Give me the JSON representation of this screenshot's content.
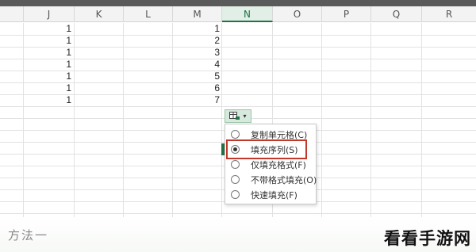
{
  "columns": [
    "J",
    "K",
    "L",
    "M",
    "N",
    "O",
    "P",
    "Q",
    "R"
  ],
  "selected_column": "N",
  "column_j_values": [
    "1",
    "1",
    "1",
    "1",
    "1",
    "1",
    "1"
  ],
  "column_m_values": [
    "1",
    "2",
    "3",
    "4",
    "5",
    "6",
    "7"
  ],
  "fill_button": {
    "icon": "autofill-options-icon",
    "caret": "▾"
  },
  "menu": {
    "items": [
      {
        "label": "复制单元格(C)",
        "checked": false
      },
      {
        "label": "填充序列(S)",
        "checked": true
      },
      {
        "label": "仅填充格式(F)",
        "checked": false
      },
      {
        "label": "不带格式填充(O)",
        "checked": false
      },
      {
        "label": "快速填充(F)",
        "checked": false
      }
    ],
    "highlighted_index": 1
  },
  "caption": "方法一",
  "watermark": "看看手游网",
  "colors": {
    "highlight": "#c0392b",
    "accent": "#217346"
  }
}
